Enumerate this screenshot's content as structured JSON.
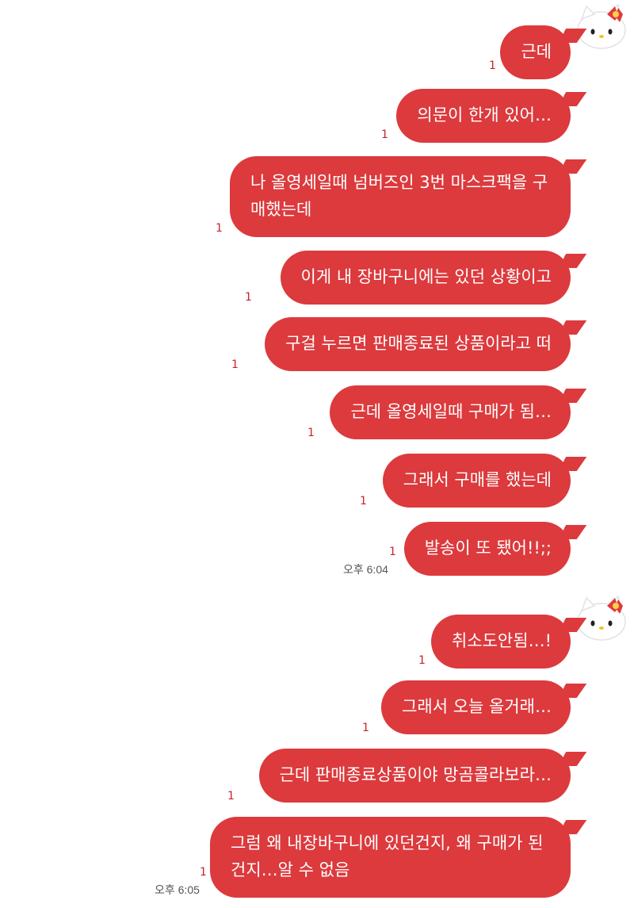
{
  "theme": {
    "bubble_color": "#dc3a3d",
    "unread_color": "#c8232a"
  },
  "avatar_icon": "hello-kitty-avatar",
  "groups": [
    {
      "messages": [
        {
          "text": "근데",
          "unread": "1"
        },
        {
          "text": "의문이 한개 있어…",
          "unread": "1"
        },
        {
          "text": "나 올영세일때 넘버즈인 3번 마스크팩을 구매했는데",
          "unread": "1"
        },
        {
          "text": "이게 내 장바구니에는 있던 상황이고",
          "unread": "1"
        },
        {
          "text": "구걸 누르면 판매종료된 상품이라고 떠",
          "unread": "1"
        },
        {
          "text": "근데 올영세일때 구매가 됨…",
          "unread": "1"
        },
        {
          "text": "그래서 구매를 했는데",
          "unread": "1"
        },
        {
          "text": "발송이 또 됐어!!;;",
          "unread": "1"
        }
      ],
      "time": "오후 6:04"
    },
    {
      "messages": [
        {
          "text": "취소도안됨…!",
          "unread": "1"
        },
        {
          "text": "그래서 오늘 올거래…",
          "unread": "1"
        },
        {
          "text": "근데 판매종료상품이야 망곰콜라보라…",
          "unread": "1"
        },
        {
          "text": "그럼 왜 내장바구니에 있던건지, 왜 구매가 된건지…알 수 없음",
          "unread": "1"
        }
      ],
      "time": "오후 6:05"
    }
  ]
}
